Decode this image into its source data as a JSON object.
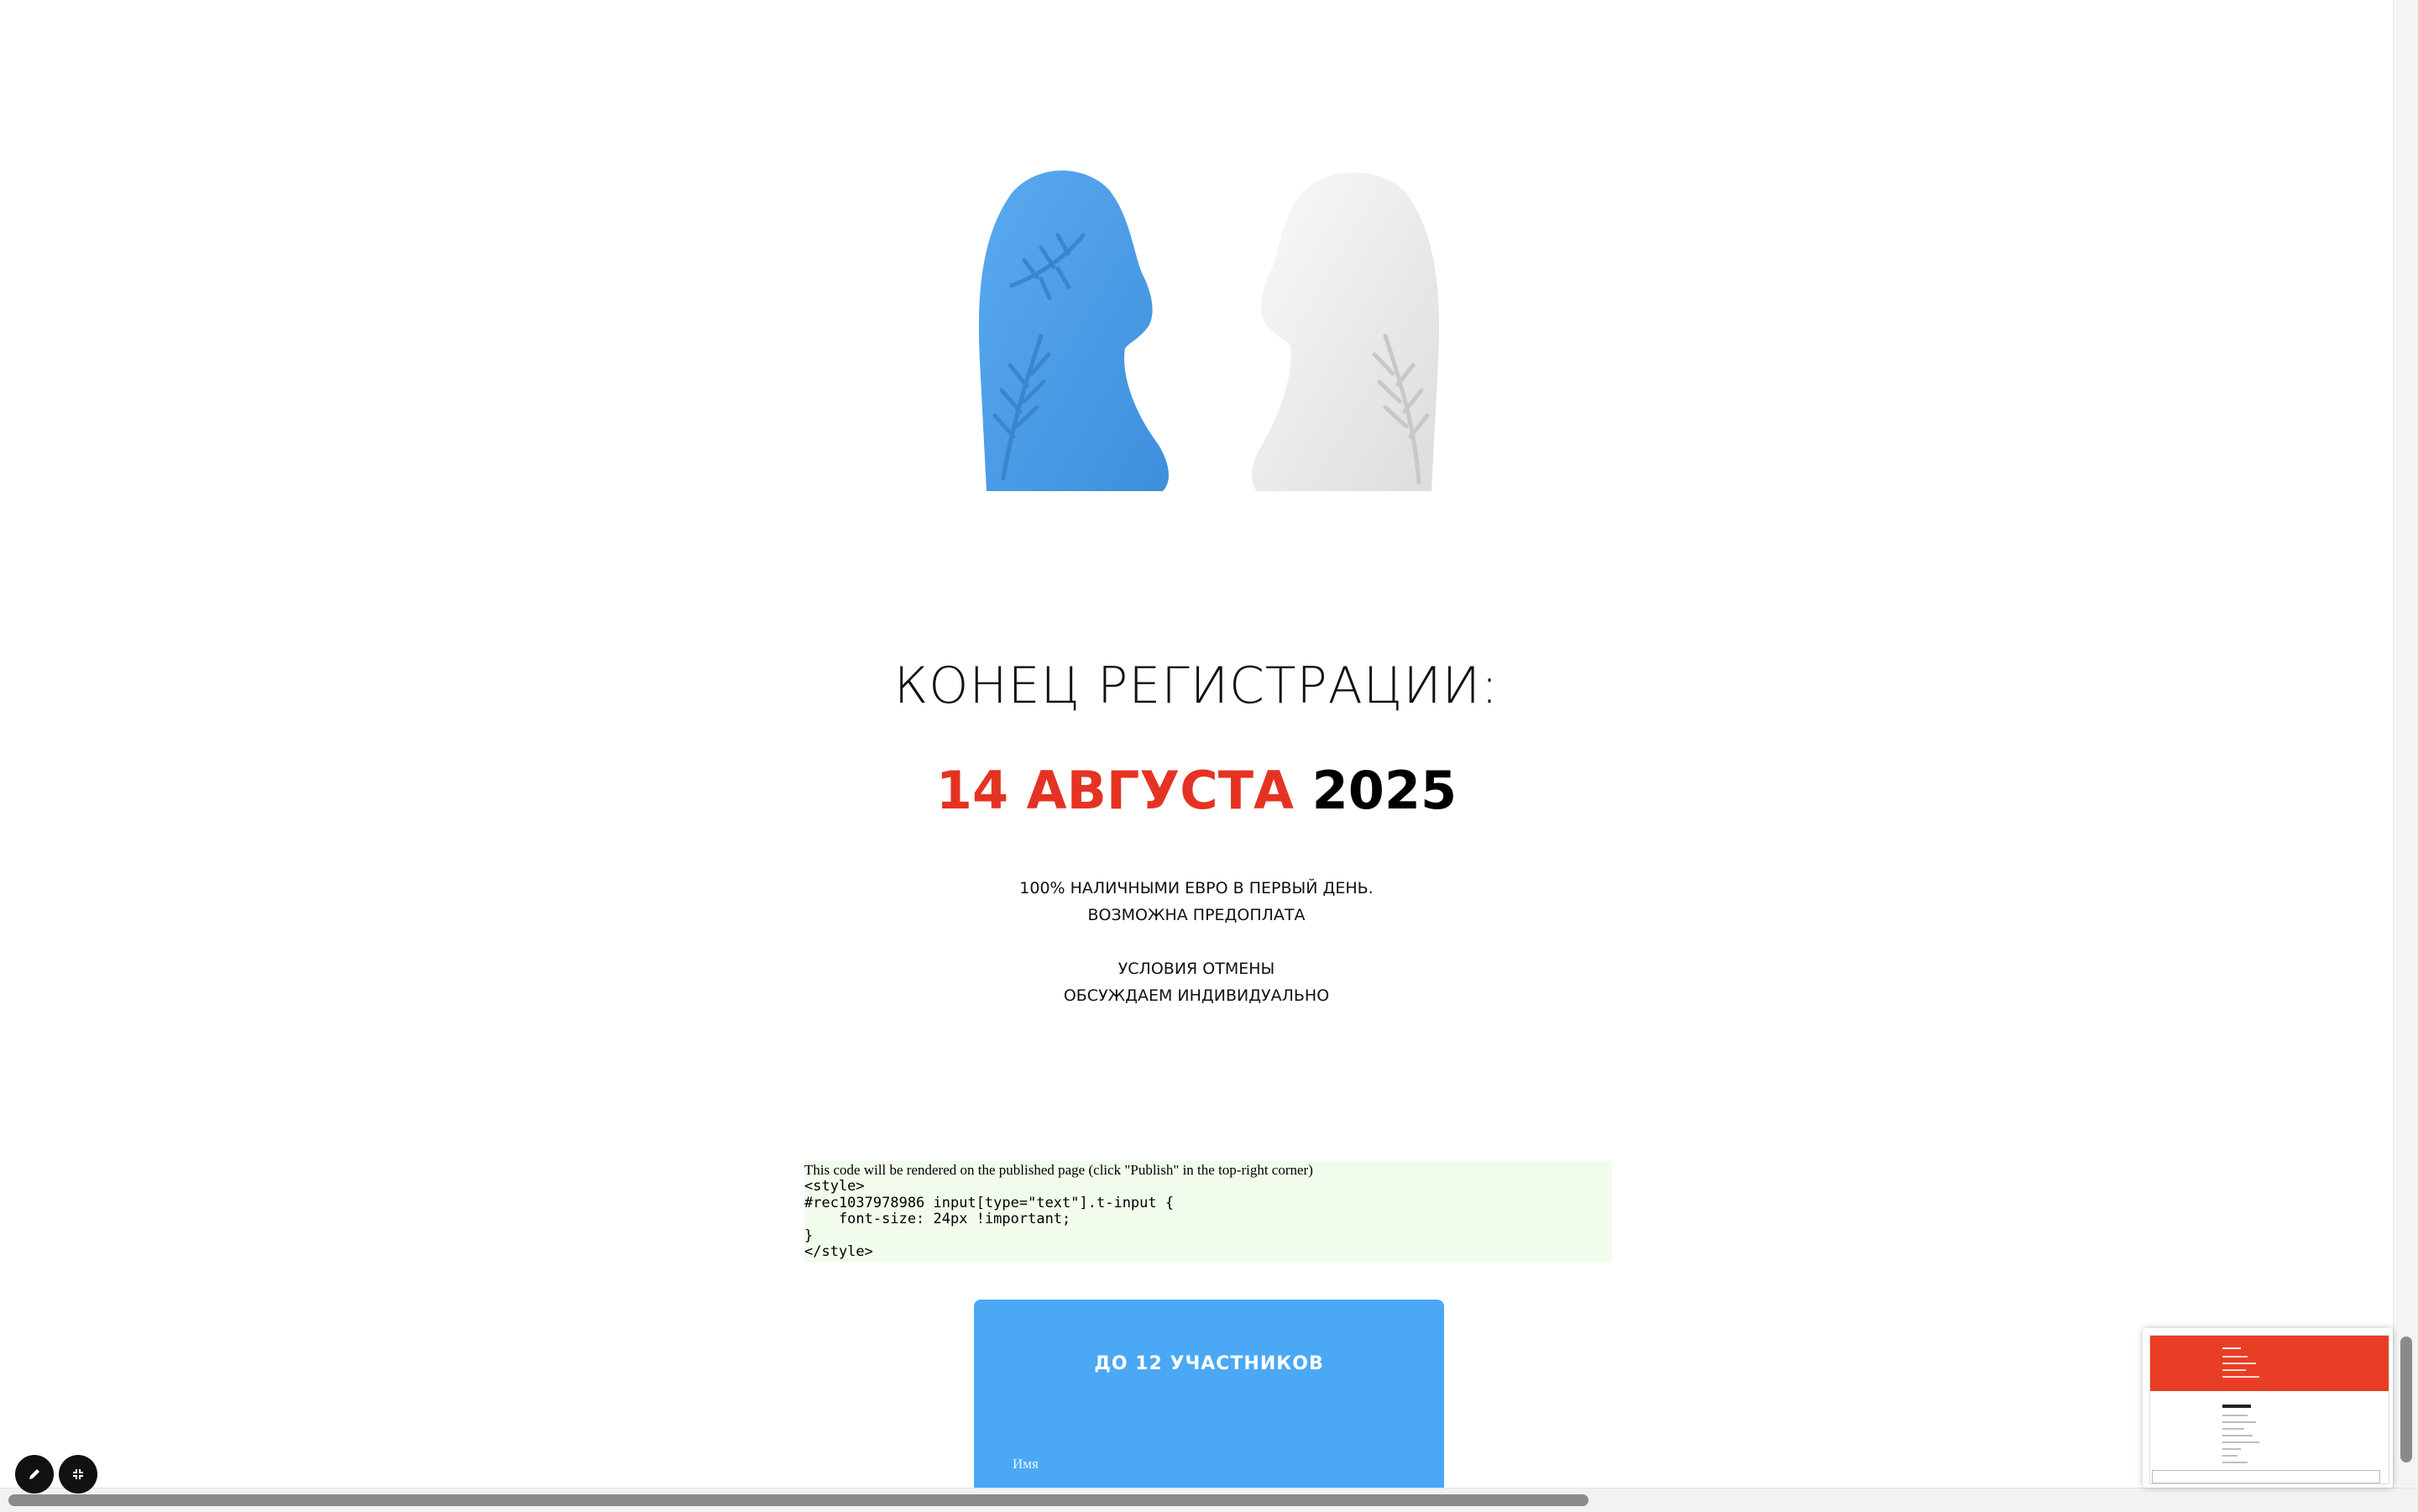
{
  "registration": {
    "title": "КОНЕЦ РЕГИСТРАЦИИ:",
    "date_accent": "14 АВГУСТА",
    "date_year": "2025"
  },
  "notes": {
    "line1": "100% НАЛИЧНЫМИ ЕВРО В ПЕРВЫЙ ДЕНЬ.",
    "line2": "ВОЗМОЖНА ПРЕДОПЛАТА",
    "line3": "УСЛОВИЯ ОТМЕНЫ",
    "line4": "ОБСУЖДАЕМ ИНДИВИДУАЛЬНО"
  },
  "code_block": {
    "note": "This code will be rendered on the published page (click \"Publish\" in the top-right corner)",
    "code": "<style>\n#rec1037978986 input[type=\"text\"].t-input {\n    font-size: 24px !important;\n}\n</style>"
  },
  "form": {
    "title": "ДО 12 УЧАСТНИКОВ",
    "name_placeholder": "Имя"
  },
  "colors": {
    "accent_red": "#e53323",
    "form_blue": "#4aa8f5",
    "sculpture_blue": "#4b9ee6",
    "code_bg": "#f1fcec"
  },
  "icons": {
    "edit_button": "pencil-icon",
    "fullscreen_button": "collapse-icon"
  }
}
